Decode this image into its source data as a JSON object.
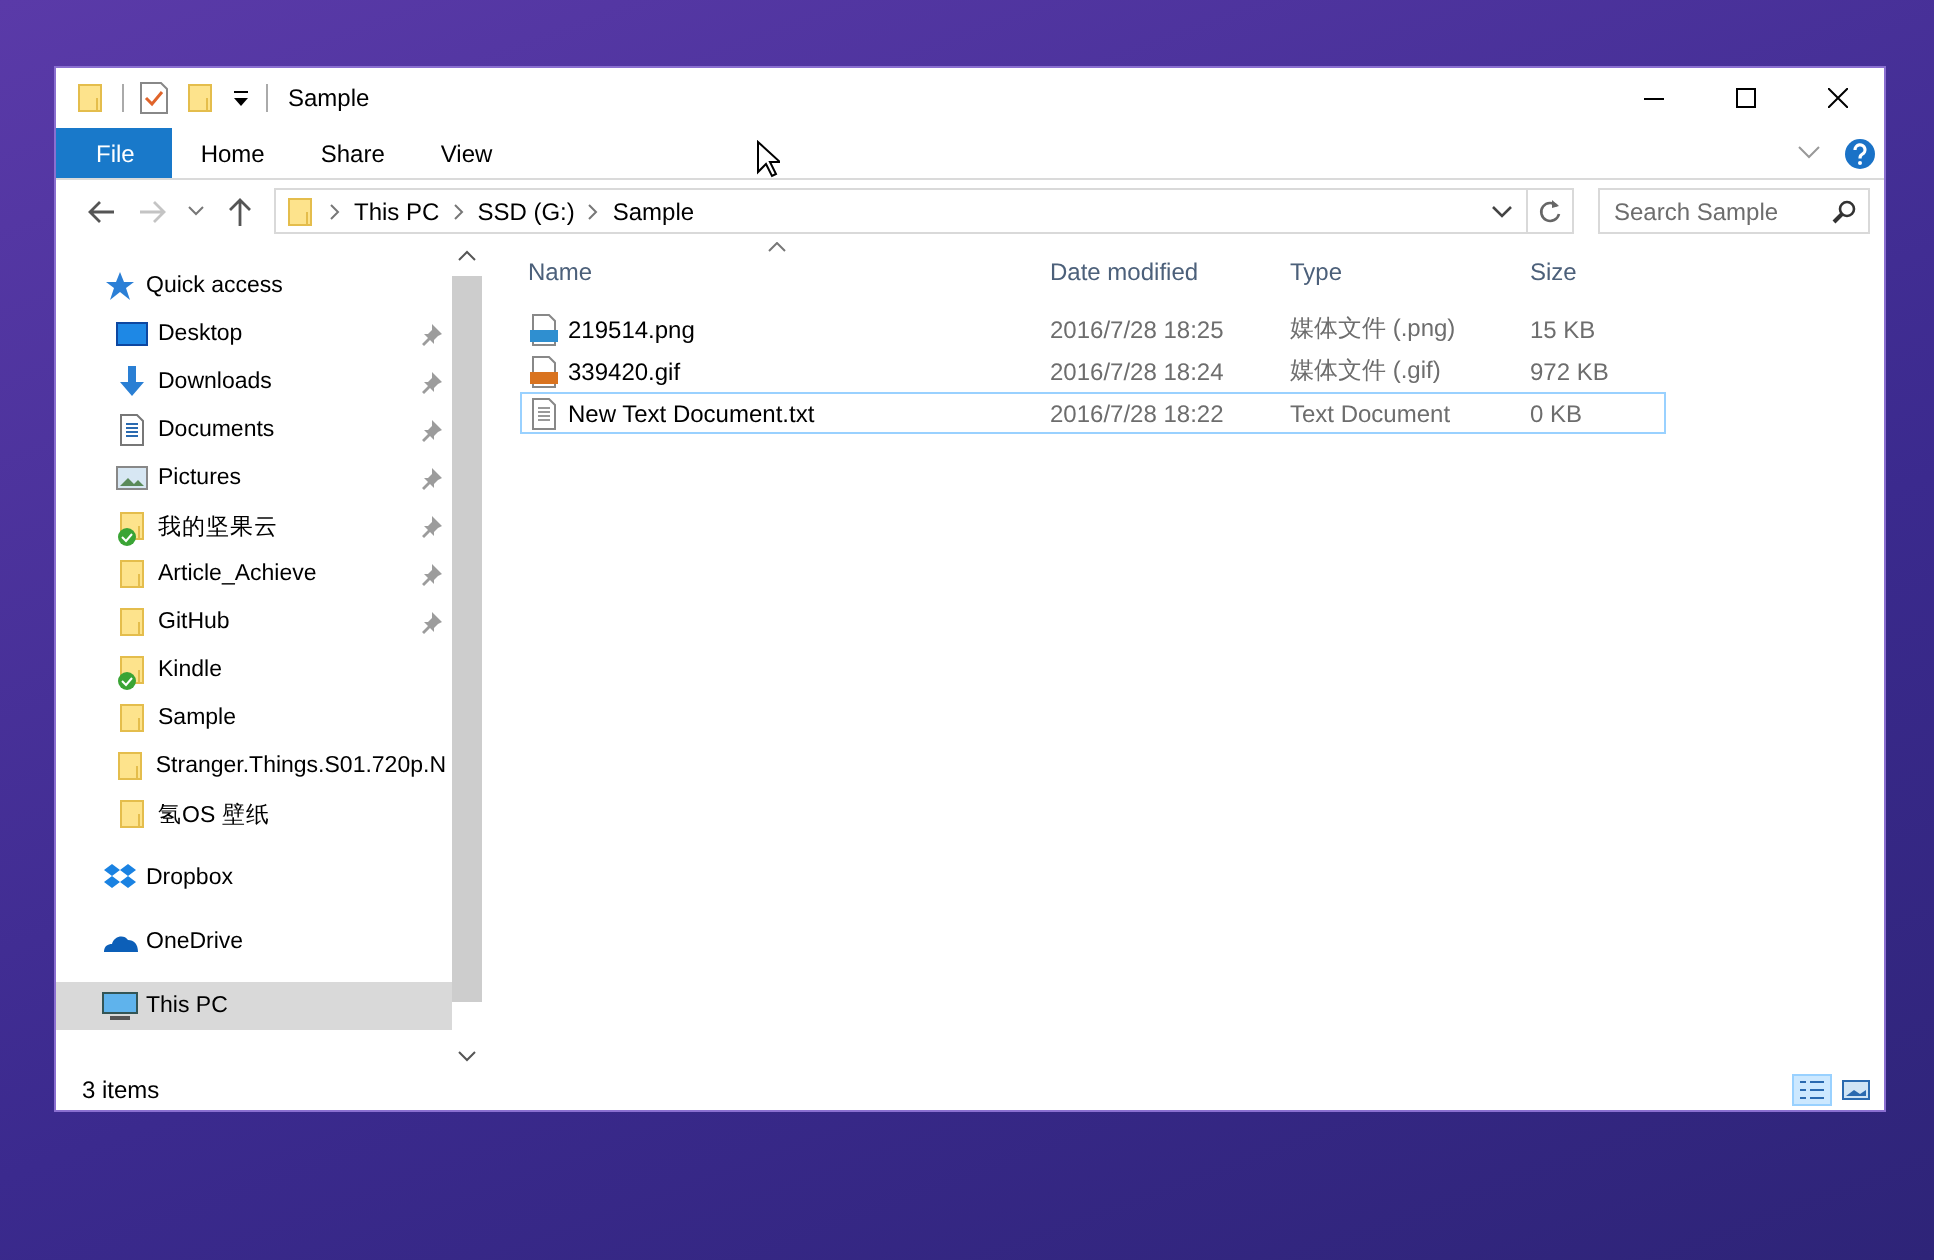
{
  "window": {
    "title": "Sample"
  },
  "ribbon_tabs": [
    {
      "label": "File",
      "kind": "file"
    },
    {
      "label": "Home",
      "kind": "tab"
    },
    {
      "label": "Share",
      "kind": "tab"
    },
    {
      "label": "View",
      "kind": "tab"
    }
  ],
  "address": {
    "crumbs": [
      "This PC",
      "SSD (G:)",
      "Sample"
    ]
  },
  "search": {
    "placeholder": "Search Sample"
  },
  "navigation": [
    {
      "label": "Quick access",
      "kind": "star",
      "selected": false,
      "children": [
        {
          "label": "Desktop",
          "kind": "desktop",
          "pinned": true,
          "synced": false,
          "selected": false
        },
        {
          "label": "Downloads",
          "kind": "download",
          "pinned": true,
          "synced": false,
          "selected": false
        },
        {
          "label": "Documents",
          "kind": "documents",
          "pinned": true,
          "synced": false,
          "selected": false
        },
        {
          "label": "Pictures",
          "kind": "pictures",
          "pinned": true,
          "synced": false,
          "selected": false
        },
        {
          "label": "我的坚果云",
          "kind": "folder",
          "pinned": true,
          "synced": true,
          "selected": false
        },
        {
          "label": "Article_Achieve",
          "kind": "folder",
          "pinned": true,
          "synced": false,
          "selected": false
        },
        {
          "label": "GitHub",
          "kind": "folder",
          "pinned": true,
          "synced": false,
          "selected": false
        },
        {
          "label": "Kindle",
          "kind": "folder",
          "pinned": false,
          "synced": true,
          "selected": false
        },
        {
          "label": "Sample",
          "kind": "folder",
          "pinned": false,
          "synced": false,
          "selected": false
        },
        {
          "label": "Stranger.Things.S01.720p.N",
          "kind": "folder",
          "pinned": false,
          "synced": false,
          "selected": false
        },
        {
          "label": "氢OS 壁纸",
          "kind": "folder",
          "pinned": false,
          "synced": false,
          "selected": false
        }
      ]
    },
    {
      "label": "Dropbox",
      "kind": "dropbox",
      "selected": false
    },
    {
      "label": "OneDrive",
      "kind": "onedrive",
      "selected": false
    },
    {
      "label": "This PC",
      "kind": "pc",
      "selected": true
    }
  ],
  "files": {
    "columns": [
      {
        "label": "Name",
        "sorted": true
      },
      {
        "label": "Date modified",
        "sorted": false
      },
      {
        "label": "Type",
        "sorted": false
      },
      {
        "label": "Size",
        "sorted": false
      }
    ],
    "rows": [
      {
        "kind": "png",
        "name": "219514.png",
        "date": "2016/7/28 18:25",
        "type": "媒体文件 (.png)",
        "size": "15 KB",
        "selected": false,
        "focused": false
      },
      {
        "kind": "gif",
        "name": "339420.gif",
        "date": "2016/7/28 18:24",
        "type": "媒体文件 (.gif)",
        "size": "972 KB",
        "selected": false,
        "focused": false
      },
      {
        "kind": "txt",
        "name": "New Text Document.txt",
        "date": "2016/7/28 18:22",
        "type": "Text Document",
        "size": "0 KB",
        "selected": false,
        "focused": true
      }
    ]
  },
  "status_bar": {
    "text": "3 items",
    "views": [
      {
        "kind": "details",
        "selected": true
      },
      {
        "kind": "tiles",
        "selected": false
      }
    ]
  }
}
